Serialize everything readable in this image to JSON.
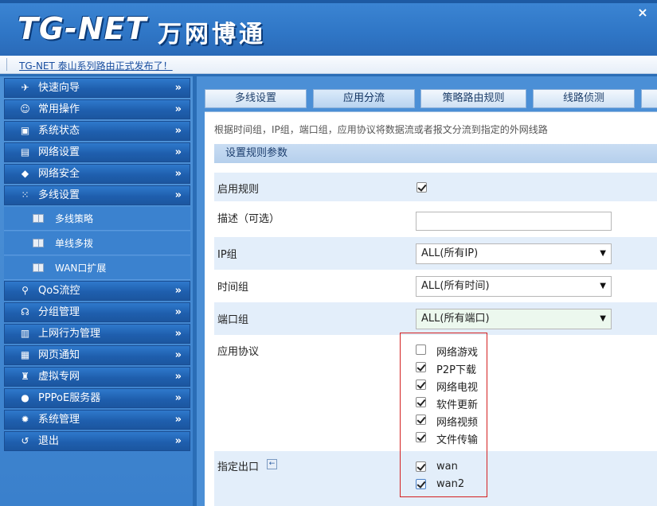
{
  "header": {
    "logo_en": "TG-NET",
    "logo_cn": "万网博通",
    "close": "×"
  },
  "notice": {
    "text": "TG-NET 泰山系列路由正式发布了！"
  },
  "sidebar": {
    "items": [
      {
        "label": "快速向导",
        "icon": "wizard-icon",
        "arrow": "»"
      },
      {
        "label": "常用操作",
        "icon": "common-ops-icon",
        "arrow": "»"
      },
      {
        "label": "系统状态",
        "icon": "system-status-icon",
        "arrow": "»"
      },
      {
        "label": "网络设置",
        "icon": "network-settings-icon",
        "arrow": "»"
      },
      {
        "label": "网络安全",
        "icon": "shield-icon",
        "arrow": "»"
      },
      {
        "label": "多线设置",
        "icon": "multi-line-icon",
        "arrow": "»"
      },
      {
        "label": "QoS流控",
        "icon": "qos-icon",
        "arrow": "»"
      },
      {
        "label": "分组管理",
        "icon": "group-icon",
        "arrow": "»"
      },
      {
        "label": "上网行为管理",
        "icon": "behavior-icon",
        "arrow": "»"
      },
      {
        "label": "网页通知",
        "icon": "web-notify-icon",
        "arrow": "»"
      },
      {
        "label": "虚拟专网",
        "icon": "vpn-icon",
        "arrow": "»"
      },
      {
        "label": "PPPoE服务器",
        "icon": "pppoe-icon",
        "arrow": "»"
      },
      {
        "label": "系统管理",
        "icon": "gear-icon",
        "arrow": "»"
      },
      {
        "label": "退出",
        "icon": "exit-icon",
        "arrow": "»"
      }
    ],
    "subitems": [
      {
        "label": "多线策略"
      },
      {
        "label": "单线多拨"
      },
      {
        "label": "WAN口扩展"
      }
    ]
  },
  "tabs": [
    {
      "label": "多线设置"
    },
    {
      "label": "应用分流"
    },
    {
      "label": "策略路由规则"
    },
    {
      "label": "线路侦测"
    }
  ],
  "main": {
    "description": "根据时间组，IP组，端口组，应用协议将数据流或者报文分流到指定的外网线路",
    "section_title": "设置规则参数",
    "enable_label": "启用规则",
    "enable_checked": true,
    "desc_label": "描述（可选）",
    "desc_value": "",
    "ip_group_label": "IP组",
    "ip_group_value": "ALL(所有IP)",
    "time_group_label": "时间组",
    "time_group_value": "ALL(所有时间)",
    "port_group_label": "端口组",
    "port_group_value": "ALL(所有端口)",
    "protocol_label": "应用协议",
    "protocols": [
      {
        "label": "网络游戏",
        "checked": false
      },
      {
        "label": "P2P下载",
        "checked": true
      },
      {
        "label": "网络电视",
        "checked": true
      },
      {
        "label": "软件更新",
        "checked": true
      },
      {
        "label": "网络视频",
        "checked": true
      },
      {
        "label": "文件传输",
        "checked": true
      }
    ],
    "outlet_label": "指定出口",
    "outlets": [
      {
        "label": "wan",
        "checked": true
      },
      {
        "label": "wan2",
        "checked": true
      }
    ],
    "caret": "▼"
  },
  "colors": {
    "header_blue": "#2f76c6",
    "sidebar_item": "#1f5fae",
    "highlight_box": "#d42020"
  }
}
